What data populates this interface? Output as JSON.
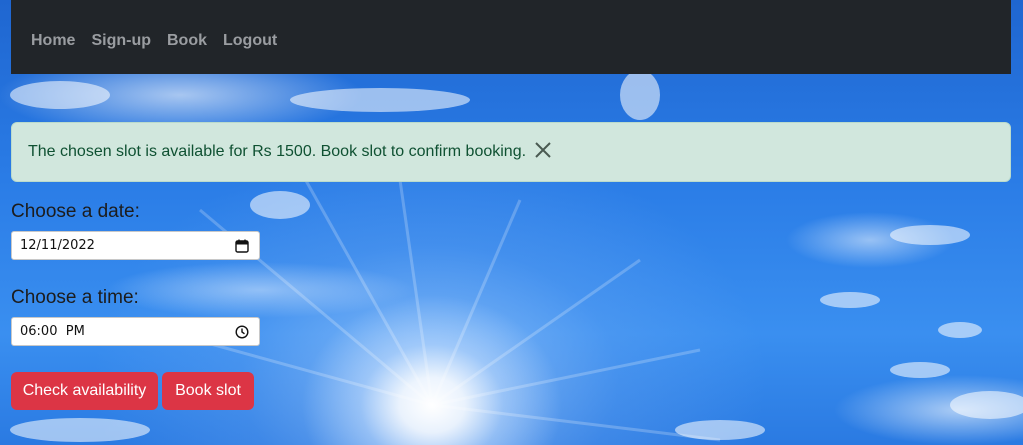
{
  "nav": {
    "items": [
      {
        "label": "Home"
      },
      {
        "label": "Sign-up"
      },
      {
        "label": "Book"
      },
      {
        "label": "Logout"
      }
    ]
  },
  "alert": {
    "message": "The chosen slot is available for Rs 1500. Book slot to confirm booking.",
    "close_icon": "close-icon"
  },
  "form": {
    "date_label": "Choose a date:",
    "date_value": "12/11/2022",
    "date_icon": "calendar-icon",
    "time_label": "Choose a time:",
    "time_value": "06:00  PM",
    "time_icon": "clock-icon"
  },
  "buttons": {
    "check_label": "Check availability",
    "book_label": "Book slot"
  },
  "colors": {
    "navbar": "#212529",
    "alert_bg": "#d1e7dd",
    "alert_text": "#0f5132",
    "button": "#dc3545"
  }
}
